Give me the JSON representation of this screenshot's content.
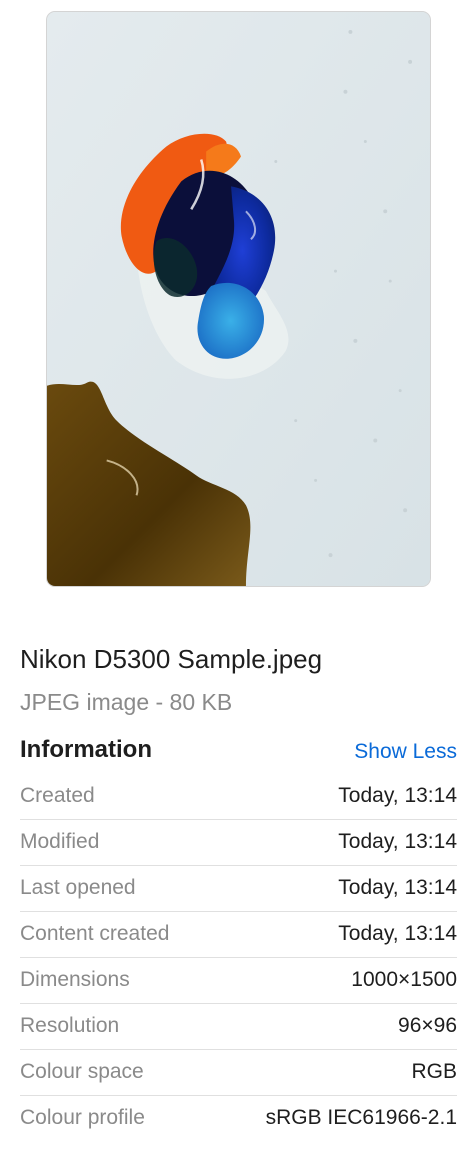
{
  "file": {
    "name": "Nikon D5300 Sample.jpeg",
    "kind_size": "JPEG image - 80 KB"
  },
  "information": {
    "title": "Information",
    "toggle_label": "Show Less",
    "rows": [
      {
        "label": "Created",
        "value": "Today, 13:14"
      },
      {
        "label": "Modified",
        "value": "Today, 13:14"
      },
      {
        "label": "Last opened",
        "value": "Today, 13:14"
      },
      {
        "label": "Content created",
        "value": "Today, 13:14"
      },
      {
        "label": "Dimensions",
        "value": "1000×1500"
      },
      {
        "label": "Resolution",
        "value": "96×96"
      },
      {
        "label": "Colour space",
        "value": "RGB"
      },
      {
        "label": "Colour profile",
        "value": "sRGB IEC61966-2.1"
      }
    ]
  },
  "colors": {
    "accent": "#0a6ad8",
    "label": "#8a8a8a",
    "text": "#1e1e1e"
  }
}
